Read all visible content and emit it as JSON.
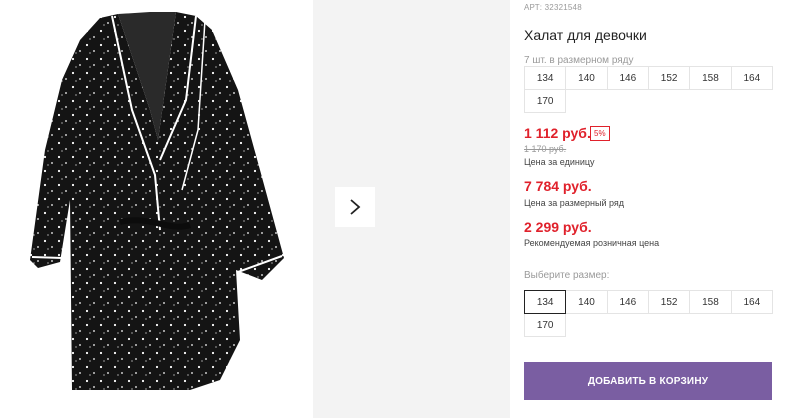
{
  "product": {
    "article": "АРТ: 32321548",
    "title": "Халат для девочки",
    "pack_note": "7 шт. в размерном ряду",
    "sizes": [
      "134",
      "140",
      "146",
      "152",
      "158",
      "164",
      "170"
    ],
    "selected_size": "134"
  },
  "pricing": {
    "unit_price": "1 112 руб.",
    "discount": "5%",
    "old_price": "1 170 руб.",
    "unit_label": "Цена за единицу",
    "row_price": "7 784 руб.",
    "row_label": "Цена за размерный ряд",
    "retail_price": "2 299 руб.",
    "retail_label": "Рекомендуемая розничная цена"
  },
  "size_select": {
    "label": "Выберите размер:"
  },
  "actions": {
    "add_to_cart": "ДОБАВИТЬ В КОРЗИНУ"
  },
  "icons": {
    "next": "chevron-right-icon"
  },
  "colors": {
    "accent": "#7a5ea2",
    "price": "#e0212b"
  }
}
